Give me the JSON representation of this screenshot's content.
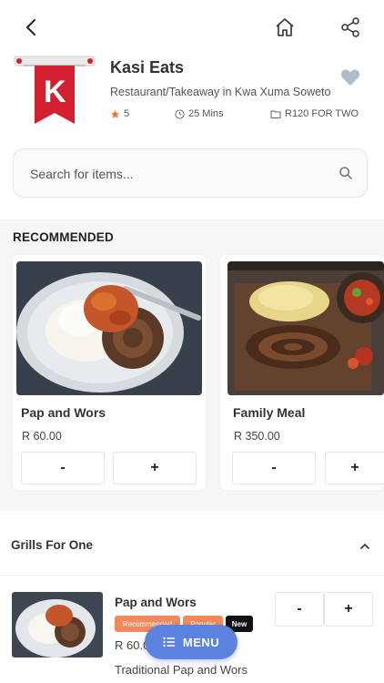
{
  "header": {
    "back_icon": "chevron-left-icon",
    "home_icon": "home-icon",
    "share_icon": "share-icon"
  },
  "restaurant": {
    "name": "Kasi Eats",
    "logo_letter": "K",
    "description": "Restaurant/Takeaway in Kwa Xuma Soweto",
    "rating": "5",
    "delivery_time": "25 Mins",
    "price_for_two": "R120 FOR TWO",
    "favorite_icon": "heart-icon"
  },
  "search": {
    "placeholder": "Search for items..."
  },
  "recommended": {
    "title": "RECOMMENDED",
    "items": [
      {
        "name": "Pap and Wors",
        "price": "R 60.00",
        "minus": "-",
        "plus": "+"
      },
      {
        "name": "Family Meal",
        "price": "R 350.00",
        "minus": "-",
        "plus": "+"
      }
    ]
  },
  "category": {
    "title": "Grills For One",
    "toggle_icon": "chevron-up-icon"
  },
  "menu_item": {
    "name": "Pap and Wors",
    "badges": [
      "Recommended",
      "Popular",
      "New"
    ],
    "price": "R 60.00",
    "description": "Traditional Pap and Wors",
    "minus": "-",
    "plus": "+"
  },
  "fab": {
    "label": "MENU",
    "icon": "list-icon"
  },
  "colors": {
    "brand_red": "#d32030",
    "star": "#e8743b",
    "badge_orange": "#f08a5d",
    "badge_black": "#111111",
    "fab_blue": "#5d83e0",
    "heart_gray": "#aebdcc"
  }
}
